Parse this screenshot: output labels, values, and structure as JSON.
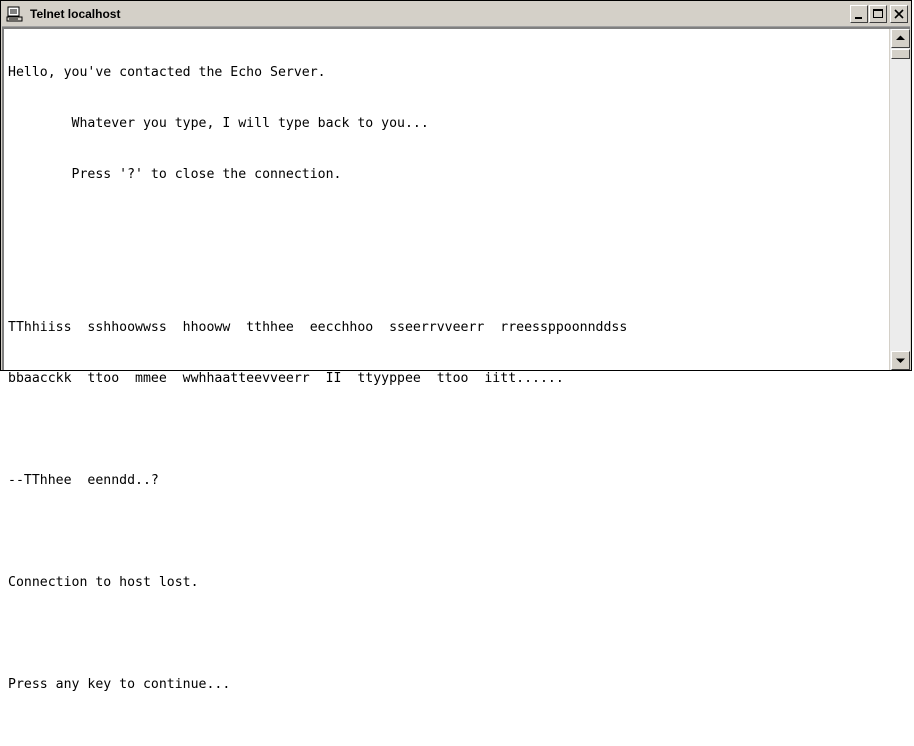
{
  "window": {
    "title": "Telnet localhost",
    "icon": "telnet-computer-icon",
    "controls": {
      "minimize": "minimize-icon",
      "maximize": "maximize-icon",
      "close": "close-icon"
    }
  },
  "terminal": {
    "lines": [
      "Hello, you've contacted the Echo Server.",
      "        Whatever you type, I will type back to you...",
      "        Press '?' to close the connection.",
      "",
      "",
      "TThhiiss  sshhoowwss  hhooww  tthhee  eecchhoo  sseerrvveerr  rreessppoonnddss",
      "bbaacckk  ttoo  mmee  wwhhaatteevveerr  II  ttyyppee  ttoo  iitt......",
      "",
      "--TThhee  eenndd..?",
      "",
      "Connection to host lost.",
      "",
      "Press any key to continue...",
      ""
    ]
  },
  "scrollbar": {
    "up_icon": "scroll-up-arrow-icon",
    "down_icon": "scroll-down-arrow-icon"
  }
}
